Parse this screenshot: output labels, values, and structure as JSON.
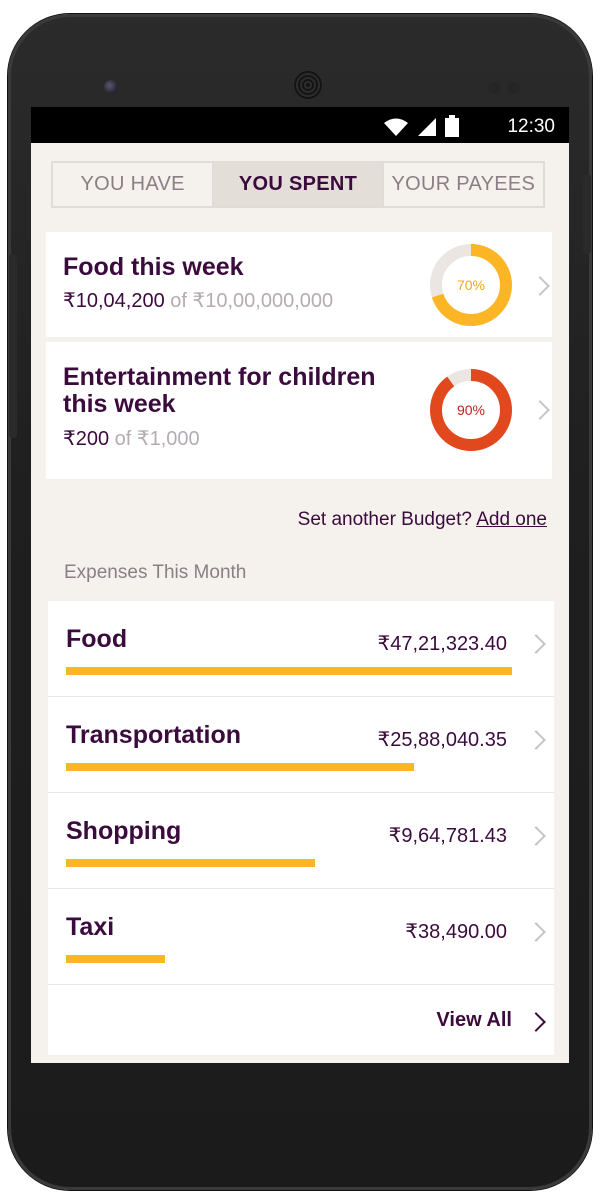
{
  "statusbar": {
    "time": "12:30",
    "icons": [
      "wifi-icon",
      "signal-icon",
      "battery-icon"
    ]
  },
  "tabs": [
    {
      "label": "YOU HAVE",
      "active": false
    },
    {
      "label": "YOU SPENT",
      "active": true
    },
    {
      "label": "YOUR PAYEES",
      "active": false
    }
  ],
  "budgets": [
    {
      "title": "Food this week",
      "spent": "₹10,04,200",
      "of_label": "of",
      "limit": "₹10,00,000,000",
      "percent": 70,
      "percent_label": "70%",
      "color": "#fcb625",
      "label_color": "#f0a81b"
    },
    {
      "title": "Entertainment for children this week",
      "spent": "₹200",
      "of_label": "of",
      "limit": "₹1,000",
      "percent": 90,
      "percent_label": "90%",
      "color": "#e2481d",
      "label_color": "#c0201a"
    }
  ],
  "set_another": {
    "text": "Set another Budget?",
    "link": "Add one"
  },
  "expenses_title": "Expenses This Month",
  "expenses": [
    {
      "name": "Food",
      "amount": "₹47,21,323.40",
      "fraction": 1.0
    },
    {
      "name": "Transportation",
      "amount": "₹25,88,040.35",
      "fraction": 0.78
    },
    {
      "name": "Shopping",
      "amount": "₹9,64,781.43",
      "fraction": 0.558
    },
    {
      "name": "Taxi",
      "amount": "₹38,490.00",
      "fraction": 0.222
    }
  ],
  "view_all": "View All",
  "colors": {
    "brand_purple": "#3a0b3c",
    "accent_orange": "#fcb625",
    "background": "#f5f1ed",
    "donut_track": "#ebe6e2"
  }
}
